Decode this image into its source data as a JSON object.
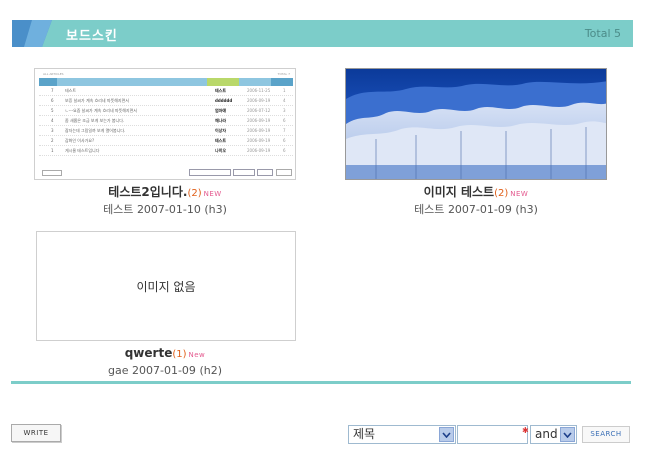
{
  "header": {
    "title": "보드스킨",
    "total": "Total 5",
    "accent": "#7ccdc9"
  },
  "items": [
    {
      "title": "테스트2입니다.",
      "count": "(2)",
      "new": "NEW",
      "author": "테스트",
      "date": "2007-01-10",
      "hits": "(h3)",
      "thumbnail": "board-screenshot"
    },
    {
      "title": "이미지 테스트",
      "count": "(2)",
      "new": "NEW",
      "author": "테스트",
      "date": "2007-01-09",
      "hits": "(h3)",
      "thumbnail": "snowy-forest-photo"
    },
    {
      "title": "qwerte",
      "count": "(1)",
      "new": "New",
      "author": "gae",
      "date": "2007-01-09",
      "hits": "(h2)",
      "thumbnail": "none",
      "no_image_text": "이미지 없음"
    }
  ],
  "mini_board": {
    "rows": [
      {
        "n": "7",
        "t": "테스트",
        "w": "테스트",
        "d": "2006-11-25",
        "h": "1"
      },
      {
        "n": "6",
        "t": "보증 날씨가 계속 흐리네 따뜻해지면서",
        "w": "dddddd",
        "d": "2006-09-19",
        "h": "4"
      },
      {
        "n": "5",
        "t": "ㄴ---요즘 날씨가 계속 흐리네 따뜻해지면서",
        "w": "엄마얘",
        "d": "2006-07-12",
        "h": "3"
      },
      {
        "n": "4",
        "t": "좀 새롭은 조금 보게 보는가 봅니다.",
        "w": "깨나라",
        "d": "2006-09-19",
        "h": "6"
      },
      {
        "n": "3",
        "t": "잠자는데 그림일까 보게 열어봅니다.",
        "w": "이상자",
        "d": "2006-09-19",
        "h": "7"
      },
      {
        "n": "2",
        "t": "감화인 이사가요?",
        "w": "테스트",
        "d": "2006-09-19",
        "h": "6"
      },
      {
        "n": "1",
        "t": "게시물 테스트입니다",
        "w": "나히오",
        "d": "2006-09-19",
        "h": "6"
      }
    ]
  },
  "footer": {
    "write_label": "WRITE",
    "field_select": "제목",
    "search_value": "",
    "operator_select": "and",
    "search_label": "SEARCH"
  }
}
